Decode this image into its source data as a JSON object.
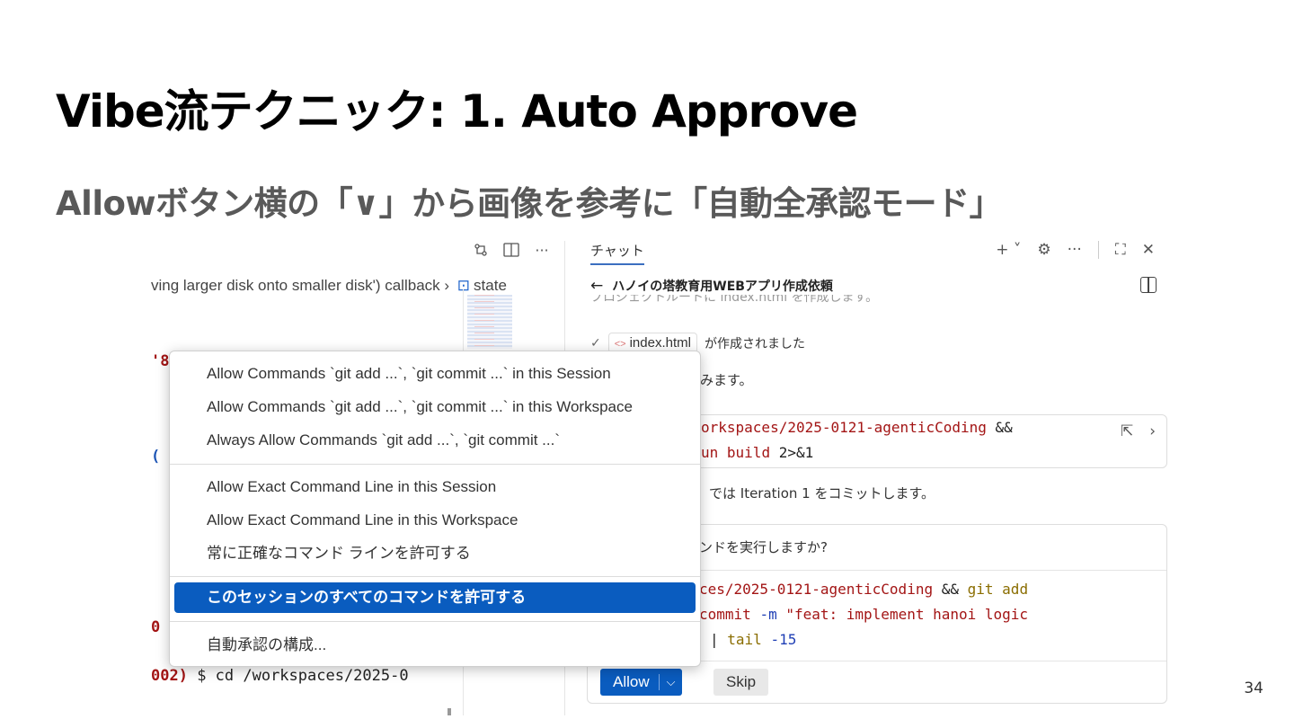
{
  "slide": {
    "title": "Vibe流テクニック: 1. Auto Approve",
    "subtitle": "Allowボタン横の「∨」から画像を参考に「自動全承認モード」",
    "page_number": "34"
  },
  "editor": {
    "toolbar_icons": [
      "compare-changes-icon",
      "split-editor-icon",
      "more-icon"
    ],
    "breadcrumb_text": "ving larger disk onto smaller disk') callback",
    "breadcrumb_symbol": "state",
    "left_fragments": [
      "'8",
      "(",
      "0"
    ],
    "terminal_prompt_number": "002)",
    "terminal_prompt_text": " $  cd /workspaces/2025-0"
  },
  "chat": {
    "tab_label": "チャット",
    "header_title": "ハノイの塔教育用WEBアプリ作成依頼",
    "faded_line": "プロジェクトルートに index.html を作成します。",
    "file_chip": "index.html",
    "file_created_text": "が作成されました",
    "msg1_tail": "みます。",
    "code1_line1": "orkspaces/2025-0121-agenticCoding",
    "code1_amp": "&&",
    "code1_line2_prefix": "un",
    "code1_line2_cmd": "build",
    "code1_line2_suffix": "2>&1",
    "msg2_tail": "では Iteration 1 をコミットします。",
    "confirm_title_tail": "ンドを実行しますか?",
    "code2_line1_path": "ces/2025-0121-agenticCoding",
    "code2_line1_amp": "&&",
    "code2_line1_git": "git add",
    "code2_line2_cmd": "commit",
    "code2_line2_flag": "-m",
    "code2_line2_msg": "\"feat: implement hanoi logic",
    "code2_line3_pipe": "|",
    "code2_line3_cmd": "tail",
    "code2_line3_arg": "-15",
    "allow_label": "Allow",
    "skip_label": "Skip"
  },
  "context_menu": {
    "items": [
      "Allow Commands `git add ...`, `git commit ...` in this Session",
      "Allow Commands `git add ...`, `git commit ...` in this Workspace",
      "Always Allow Commands `git add ...`, `git commit ...`",
      "Allow Exact Command Line in this Session",
      "Allow Exact Command Line in this Workspace",
      "常に正確なコマンド ラインを許可する",
      "このセッションのすべてのコマンドを許可する",
      "自動承認の構成..."
    ],
    "active_index": 6
  },
  "colors": {
    "accent_blue": "#0a5cbf",
    "terminal_red": "#a31515",
    "subtitle_gray": "#595959"
  }
}
